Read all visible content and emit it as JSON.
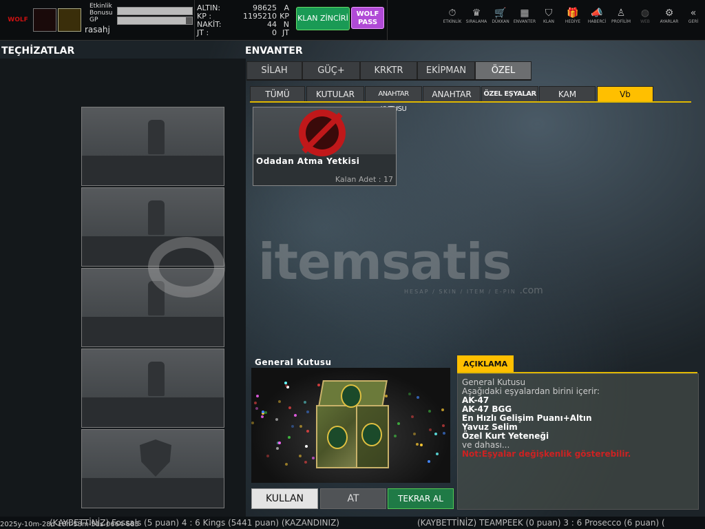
{
  "player": {
    "bonus_label_line1": "Etkinlik",
    "bonus_label_line2": "Bonusu",
    "gp_label": "GP",
    "username": "rasahj",
    "bonus_progress": 1.0,
    "gp_progress": 0.92
  },
  "currency": [
    {
      "key": "ALTIN:",
      "value": "98625",
      "unit": "A"
    },
    {
      "key": "KP :",
      "value": "1195210",
      "unit": "KP"
    },
    {
      "key": "NAKİT:",
      "value": "44",
      "unit": "N"
    },
    {
      "key": "JT :",
      "value": "0",
      "unit": "JT"
    }
  ],
  "buttons": {
    "clan_chain": "KLAN ZİNCİRİ",
    "wolf_pass_1": "WOLF",
    "wolf_pass_2": "PASS"
  },
  "nav": [
    {
      "label": "ETKİNLİK",
      "icon": "⏱",
      "name": "nav-etkinlik",
      "dim": false
    },
    {
      "label": "SIRALAMA",
      "icon": "♛",
      "name": "nav-siralama",
      "dim": false
    },
    {
      "label": "DÜKKAN",
      "icon": "🛒",
      "name": "nav-dukkan",
      "dim": false
    },
    {
      "label": "ENVANTER",
      "icon": "▦",
      "name": "nav-envanter",
      "dim": false
    },
    {
      "label": "KLAN",
      "icon": "⛉",
      "name": "nav-klan",
      "dim": false
    },
    {
      "label": "HEDİYE",
      "icon": "🎁",
      "name": "nav-hediye",
      "dim": false
    },
    {
      "label": "HABERCİ",
      "icon": "📣",
      "name": "nav-haberci",
      "dim": false
    },
    {
      "label": "PROFİLİM",
      "icon": "♙",
      "name": "nav-profilim",
      "dim": false
    },
    {
      "label": "WEB",
      "icon": "◍",
      "name": "nav-web",
      "dim": true
    },
    {
      "label": "AYARLAR",
      "icon": "⚙",
      "name": "nav-ayarlar",
      "dim": false
    },
    {
      "label": "GERİ",
      "icon": "«",
      "name": "nav-geri",
      "dim": false
    }
  ],
  "equipment": {
    "title": "TEÇHİZATLAR"
  },
  "inventory": {
    "title": "ENVANTER",
    "tabs": [
      "SİLAH",
      "GÜÇ+",
      "KRKTR",
      "EKİPMAN",
      "ÖZEL"
    ],
    "active_tab": "ÖZEL",
    "subtabs": [
      "TÜMÜ",
      "KUTULAR",
      "ANAHTAR KUTUSU",
      "ANAHTAR",
      "ÖZEL EŞYALAR",
      "KAM",
      "Vb"
    ],
    "active_subtab": "Vb",
    "items": [
      {
        "name": "Odadan Atma Yetkisi",
        "remaining": "Kalan Adet : 17"
      }
    ]
  },
  "preview": {
    "title": "General Kutusu"
  },
  "description": {
    "tab": "AÇIKLAMA",
    "line1": "General Kutusu",
    "line2": "Aşağıdaki eşyalardan birini içerir:",
    "items": [
      "AK-47",
      "AK-47 BGG",
      "En Hızlı Gelişim Puanı+Altın",
      "Yavuz Selim",
      "Özel Kurt Yeteneği"
    ],
    "more": "ve dahası...",
    "note": "Not:Eşyalar değişkenlik gösterebilir."
  },
  "actions": {
    "use": "KULLAN",
    "drop": "AT",
    "rebuy": "TEKRAR AL"
  },
  "ticker": {
    "left": "(KAYBETTİNİZ) Fossals (5 puan) 4 : 6 Kings (5441 puan) (KAZANDINIZ)",
    "right": "(KAYBETTİNİZ) TEAMPEEK (0 puan) 3 : 6 Prosecco (6 puan) (",
    "timestamp": "2025y-10m-28d-18h-58m-51s-0664-685"
  },
  "watermark": {
    "brand": "itemsatis",
    "sub": "HESAP / SKIN / ITEM / E-PIN",
    "dotcom": ".com"
  }
}
